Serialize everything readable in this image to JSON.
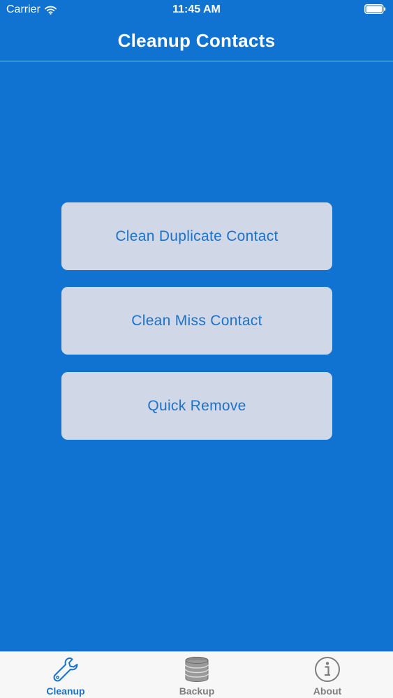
{
  "status_bar": {
    "carrier": "Carrier",
    "time": "11:45 AM"
  },
  "nav": {
    "title": "Cleanup Contacts"
  },
  "actions": [
    {
      "label": "Clean Duplicate Contact"
    },
    {
      "label": "Clean Miss Contact"
    },
    {
      "label": "Quick Remove"
    }
  ],
  "tabs": [
    {
      "label": "Cleanup",
      "icon": "wrench-icon",
      "selected": true
    },
    {
      "label": "Backup",
      "icon": "database-icon",
      "selected": false
    },
    {
      "label": "About",
      "icon": "info-icon",
      "selected": false
    }
  ],
  "colors": {
    "background": "#1073d2",
    "button_fill": "#d0d8e7",
    "accent": "#1b72cc",
    "tab_inactive": "#7d7d7d"
  }
}
